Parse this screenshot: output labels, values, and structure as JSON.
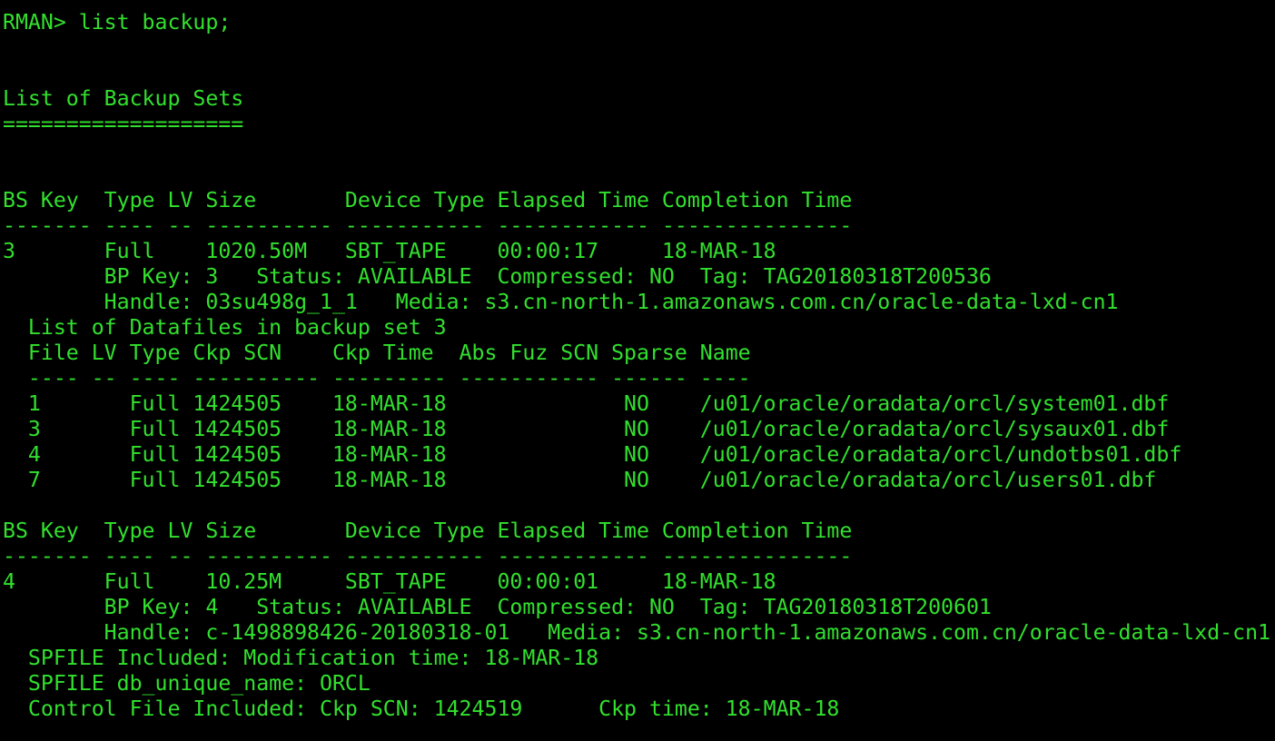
{
  "colors": {
    "background": "#000000",
    "foreground": "#32e02e"
  },
  "terminal": {
    "lines": [
      "RMAN> list backup;",
      "",
      "",
      "List of Backup Sets",
      "===================",
      "",
      "",
      "BS Key  Type LV Size       Device Type Elapsed Time Completion Time",
      "------- ---- -- ---------- ----------- ------------ ---------------",
      "3       Full    1020.50M   SBT_TAPE    00:00:17     18-MAR-18",
      "        BP Key: 3   Status: AVAILABLE  Compressed: NO  Tag: TAG20180318T200536",
      "        Handle: 03su498g_1_1   Media: s3.cn-north-1.amazonaws.com.cn/oracle-data-lxd-cn1",
      "  List of Datafiles in backup set 3",
      "  File LV Type Ckp SCN    Ckp Time  Abs Fuz SCN Sparse Name",
      "  ---- -- ---- ---------- --------- ----------- ------ ----",
      "  1       Full 1424505    18-MAR-18              NO    /u01/oracle/oradata/orcl/system01.dbf",
      "  3       Full 1424505    18-MAR-18              NO    /u01/oracle/oradata/orcl/sysaux01.dbf",
      "  4       Full 1424505    18-MAR-18              NO    /u01/oracle/oradata/orcl/undotbs01.dbf",
      "  7       Full 1424505    18-MAR-18              NO    /u01/oracle/oradata/orcl/users01.dbf",
      "",
      "BS Key  Type LV Size       Device Type Elapsed Time Completion Time",
      "------- ---- -- ---------- ----------- ------------ ---------------",
      "4       Full    10.25M     SBT_TAPE    00:00:01     18-MAR-18",
      "        BP Key: 4   Status: AVAILABLE  Compressed: NO  Tag: TAG20180318T200601",
      "        Handle: c-1498898426-20180318-01   Media: s3.cn-north-1.amazonaws.com.cn/oracle-data-lxd-cn1",
      "  SPFILE Included: Modification time: 18-MAR-18",
      "  SPFILE db_unique_name: ORCL",
      "  Control File Included: Ckp SCN: 1424519      Ckp time: 18-MAR-18"
    ]
  }
}
